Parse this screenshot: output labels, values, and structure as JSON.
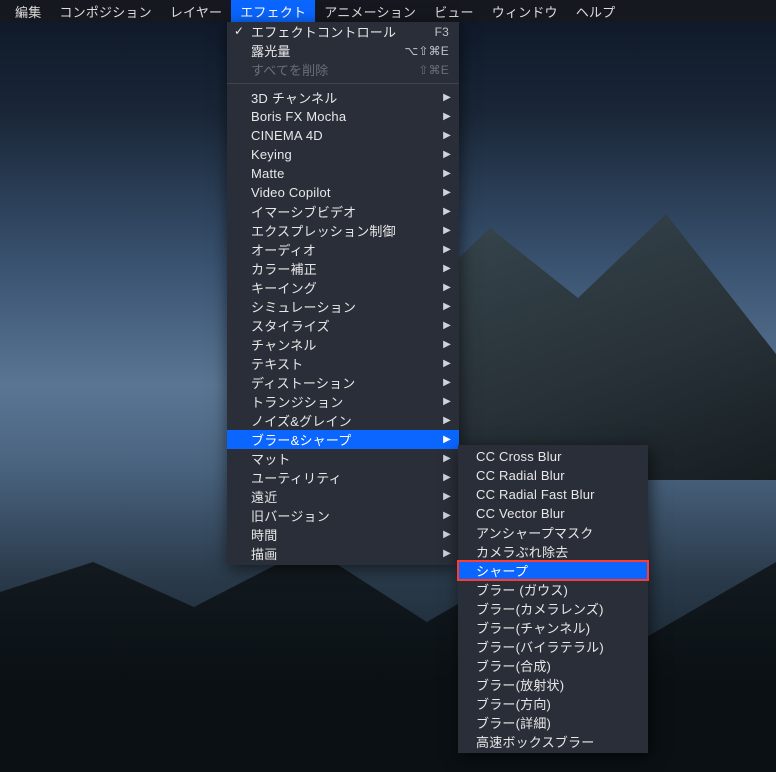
{
  "menubar": {
    "items": [
      {
        "label": "編集"
      },
      {
        "label": "コンポジション"
      },
      {
        "label": "レイヤー"
      },
      {
        "label": "エフェクト",
        "active": true
      },
      {
        "label": "アニメーション"
      },
      {
        "label": "ビュー"
      },
      {
        "label": "ウィンドウ"
      },
      {
        "label": "ヘルプ"
      }
    ]
  },
  "dropdown": {
    "top": [
      {
        "label": "エフェクトコントロール",
        "shortcut": "F3",
        "checked": true
      },
      {
        "label": "露光量",
        "shortcut": "⌥⇧⌘E"
      },
      {
        "label": "すべてを削除",
        "shortcut": "⇧⌘E",
        "disabled": true
      }
    ],
    "categories": [
      {
        "label": "3D チャンネル"
      },
      {
        "label": "Boris FX Mocha"
      },
      {
        "label": "CINEMA 4D"
      },
      {
        "label": "Keying"
      },
      {
        "label": "Matte"
      },
      {
        "label": "Video Copilot"
      },
      {
        "label": "イマーシブビデオ"
      },
      {
        "label": "エクスプレッション制御"
      },
      {
        "label": "オーディオ"
      },
      {
        "label": "カラー補正"
      },
      {
        "label": "キーイング"
      },
      {
        "label": "シミュレーション"
      },
      {
        "label": "スタイライズ"
      },
      {
        "label": "チャンネル"
      },
      {
        "label": "テキスト"
      },
      {
        "label": "ディストーション"
      },
      {
        "label": "トランジション"
      },
      {
        "label": "ノイズ&グレイン"
      },
      {
        "label": "ブラー&シャープ",
        "selected": true
      },
      {
        "label": "マット"
      },
      {
        "label": "ユーティリティ"
      },
      {
        "label": "遠近"
      },
      {
        "label": "旧バージョン"
      },
      {
        "label": "時間"
      },
      {
        "label": "描画"
      }
    ]
  },
  "submenu": {
    "items": [
      {
        "label": "CC Cross Blur"
      },
      {
        "label": "CC Radial Blur"
      },
      {
        "label": "CC Radial Fast Blur"
      },
      {
        "label": "CC Vector Blur"
      },
      {
        "label": "アンシャープマスク"
      },
      {
        "label": "カメラぶれ除去"
      },
      {
        "label": "シャープ",
        "highlight": true
      },
      {
        "label": "ブラー (ガウス)"
      },
      {
        "label": "ブラー(カメラレンズ)"
      },
      {
        "label": "ブラー(チャンネル)"
      },
      {
        "label": "ブラー(バイラテラル)"
      },
      {
        "label": "ブラー(合成)"
      },
      {
        "label": "ブラー(放射状)"
      },
      {
        "label": "ブラー(方向)"
      },
      {
        "label": "ブラー(詳細)"
      },
      {
        "label": "高速ボックスブラー"
      }
    ]
  }
}
